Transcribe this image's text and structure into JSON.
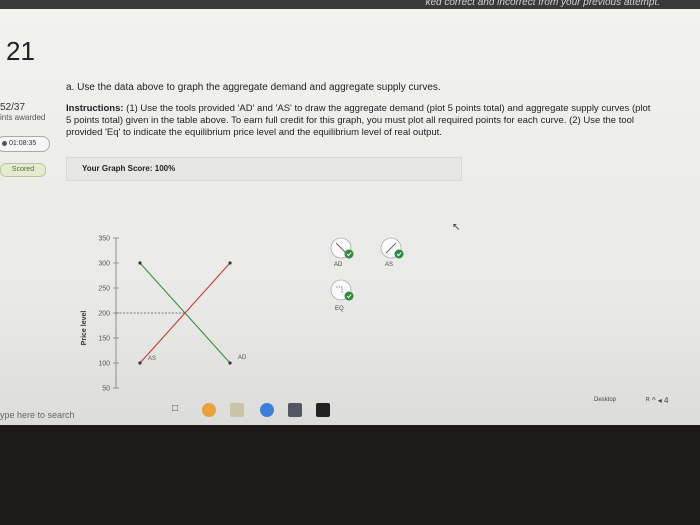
{
  "topbar": {
    "text": "ked correct and incorrect from your previous attempt."
  },
  "question": {
    "number": "21"
  },
  "sidebar": {
    "score": "52/37",
    "awarded": "ints awarded",
    "timer": "01:08:35",
    "scored": "Scored"
  },
  "part": {
    "label": "a. Use the data above to graph the aggregate demand and aggregate supply curves."
  },
  "instructions": {
    "bold": "Instructions:",
    "text": " (1) Use the tools provided 'AD' and 'AS' to draw the aggregate demand (plot 5 points total) and aggregate supply curves (plot 5 points total) given in the table above. To earn full credit for this graph, you must plot all required points for each curve. (2) Use the tool provided 'Eq' to indicate the equilibrium price level and the equilibrium level of real output."
  },
  "graph_score": {
    "text": "Your Graph Score: 100%"
  },
  "tools": {
    "ad": "AD",
    "as": "AS",
    "eq": "EQ"
  },
  "chart_data": {
    "type": "line",
    "ylabel": "Price level",
    "xlabel": "",
    "yticks": [
      "350",
      "300",
      "250",
      "200",
      "150",
      "100",
      "50"
    ],
    "ylim": [
      50,
      350
    ],
    "series": [
      {
        "name": "AD",
        "color": "#3a8a3a",
        "x": [
          1,
          2,
          3,
          4,
          5
        ],
        "y": [
          300,
          250,
          200,
          150,
          100
        ]
      },
      {
        "name": "AS",
        "color": "#c0392b",
        "x": [
          1,
          2,
          3,
          4,
          5
        ],
        "y": [
          100,
          150,
          200,
          250,
          300
        ]
      }
    ],
    "equilibrium": {
      "x": 3,
      "y": 200
    },
    "curve_labels": {
      "ad": "AD",
      "as": "AS"
    }
  },
  "taskbar": {
    "search": "ype here to search",
    "desktop": "Desktop",
    "tray": "ᴿ ^ ◂ 4"
  },
  "colors": {
    "accent": "#3a8a3a",
    "as_color": "#c0392b",
    "check": "#2d8a3e"
  }
}
